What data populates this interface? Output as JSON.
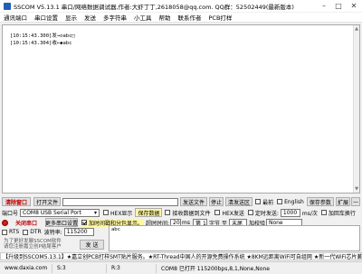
{
  "window": {
    "title": "SSCOM V5.13.1 串口/网络数据调试器,作者:大虾丁丁,2618058@qq.com. QQ群：52502449(最新版本)"
  },
  "menu": [
    "通讯端口",
    "串口设置",
    "显示",
    "发送",
    "多字符串",
    "小工具",
    "帮助",
    "联系作者",
    "PCB打样"
  ],
  "receive": {
    "lines": [
      "[10:15:43.300]发→◇abc□",
      "[10:15:43.304]收←◆abc"
    ]
  },
  "row1": {
    "clear_label": "清除窗口",
    "open_file_label": "打开文件",
    "send_file_label": "发送文件",
    "stop_label": "停止",
    "clear_send_label": "清发送区",
    "top_label": "最前",
    "english_label": "English",
    "save_params_label": "保存参数",
    "expand_label": "扩展",
    "minus_label": "—"
  },
  "row2": {
    "port_label": "端口号",
    "port_value": "COM8 USB Serial Port",
    "hex_display_label": "HEX显示",
    "save_data_label": "保存数据",
    "recv_to_file_label": "接收数据到文件",
    "hex_send_label": "HEX发送",
    "timed_send_label": "定时发送:",
    "interval_value": "1000",
    "interval_unit": "ms/次",
    "add_newline_label": "加回车换行"
  },
  "row3": {
    "close_port_label": "关闭串口",
    "more_settings_label": "更多串口设置",
    "timestamp_label": "加时间戳和分包显示。",
    "timeout_label": "超时时间:",
    "timeout_value": "20",
    "timeout_unit": "ms",
    "nth_value": "第 1",
    "byte_label": "字节 至",
    "end_value": "末尾",
    "checksum_label": "加校验",
    "checksum_value": "None"
  },
  "row4": {
    "rts_label": "RTS",
    "dtr_label": "DTR",
    "baud_label": "波特率:",
    "baud_value": "115200"
  },
  "left_hint": [
    "为了更好发展SSCOM软件",
    "请您注册嘉立创P结尾客户"
  ],
  "send": {
    "text": "abc",
    "send_label": "发 送"
  },
  "ad": "【升级到SSCOM5.13.1】★嘉立创PCB打样SMT贴片服务。★RT-Thread中国人的开源免费操作系统 ★8KM远距离WiFi可自组网 ★新一代WiFi芯片兼容",
  "status": {
    "site": "www.daxia.com",
    "s": "S:3",
    "r": "R:3",
    "port_state": "COM8 已打开  115200bps,8,1,None,None"
  },
  "colors": {
    "accent": "#c00000",
    "led_red": "#d21b1b",
    "highlight_yellow": "#fff7a0"
  }
}
